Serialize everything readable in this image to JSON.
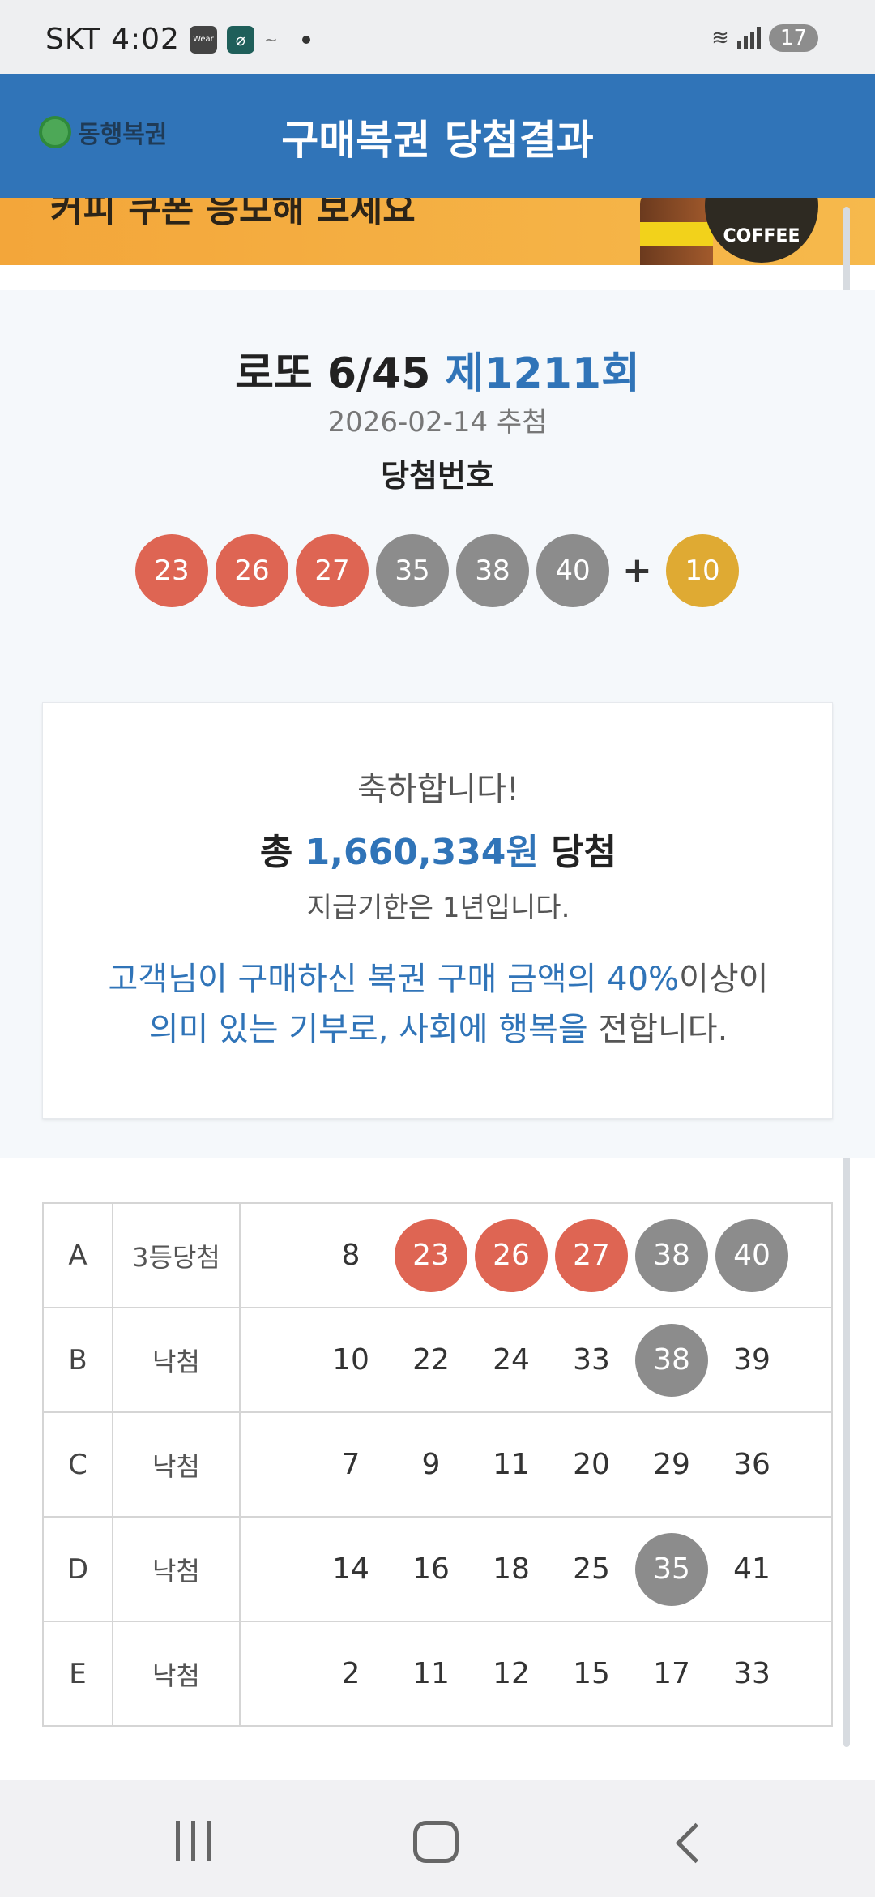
{
  "status_bar": {
    "carrier_time": "SKT 4:02",
    "wear_label": "Wear",
    "battery": "17"
  },
  "header": {
    "logo_text": "동행복권",
    "title": "구매복권 당첨결과"
  },
  "banner": {
    "text": "커피 쿠폰 응모해 보세요",
    "coin_text": "COFFEE"
  },
  "draw": {
    "game_name": "로또 6/45",
    "round": "제1211회",
    "date": "2026-02-14 추첨",
    "label": "당첨번호",
    "numbers": [
      "23",
      "26",
      "27",
      "35",
      "38",
      "40"
    ],
    "plus": "+",
    "bonus": "10"
  },
  "congrats": {
    "heading": "축하합니다!",
    "total_prefix": "총",
    "total_amount": "1,660,334원",
    "total_suffix": "당첨",
    "deadline": "지급기한은 1년입니다.",
    "donation_line1_blue": "고객님이 구매하신 복권 구매 금액의 40%",
    "donation_line1_dark": "이상이",
    "donation_line2_blue": "의미 있는 기부로, 사회에 행복을",
    "donation_line2_dark": " 전합니다."
  },
  "tickets": [
    {
      "game": "A",
      "status": "3등당첨",
      "numbers": [
        "8",
        "23",
        "26",
        "27",
        "38",
        "40"
      ]
    },
    {
      "game": "B",
      "status": "낙첨",
      "numbers": [
        "10",
        "22",
        "24",
        "33",
        "38",
        "39"
      ]
    },
    {
      "game": "C",
      "status": "낙첨",
      "numbers": [
        "7",
        "9",
        "11",
        "20",
        "29",
        "36"
      ]
    },
    {
      "game": "D",
      "status": "낙첨",
      "numbers": [
        "14",
        "16",
        "18",
        "25",
        "35",
        "41"
      ]
    },
    {
      "game": "E",
      "status": "낙첨",
      "numbers": [
        "2",
        "11",
        "12",
        "15",
        "17",
        "33"
      ]
    }
  ],
  "colors": {
    "brand_blue": "#3074b8",
    "ball_red": "#de6553",
    "ball_gray": "#8c8c8c",
    "ball_gold": "#dfaa33"
  }
}
